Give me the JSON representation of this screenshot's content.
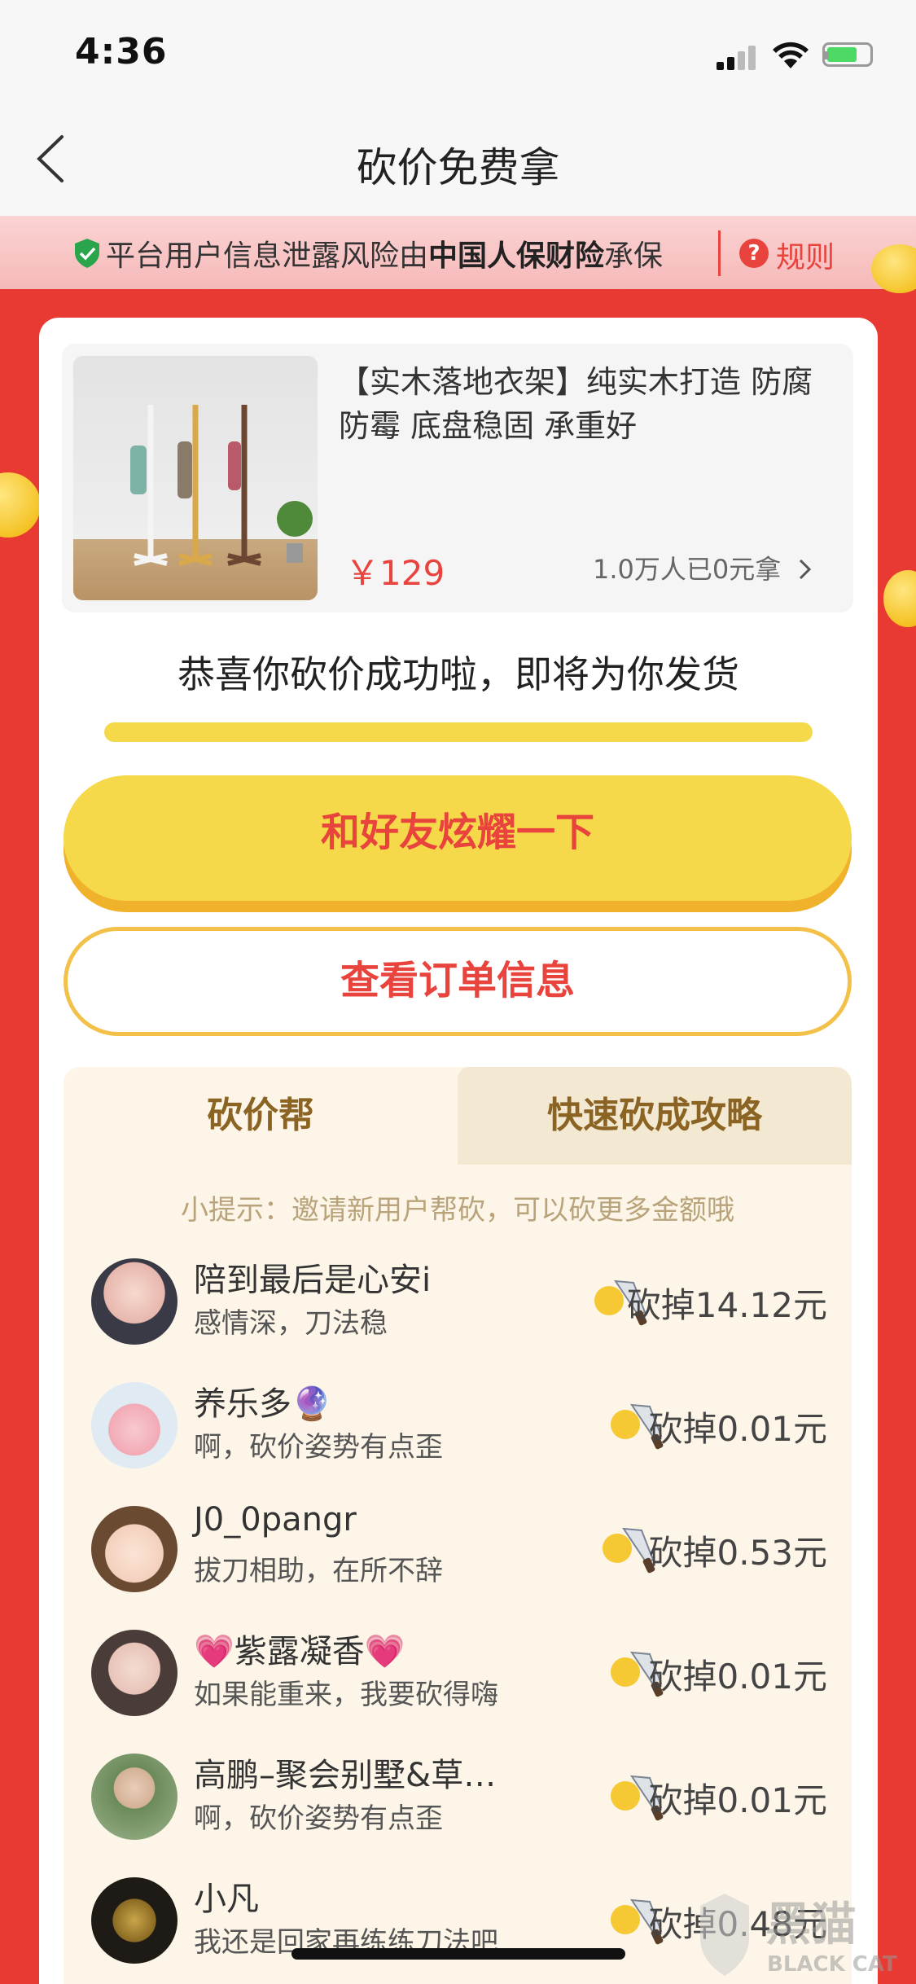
{
  "status_bar": {
    "time": "4:36"
  },
  "nav": {
    "title": "砍价免费拿"
  },
  "insurance": {
    "text_prefix": "平台用户信息泄露风险由",
    "insurer": "中国人保财险",
    "text_suffix": "承保",
    "rule_icon": "?",
    "rule_label": "规则"
  },
  "product": {
    "title": "【实木落地衣架】纯实木打造 防腐防霉 底盘稳固 承重好",
    "price": "￥129",
    "claimed": "1.0万人已0元拿"
  },
  "progress": {
    "message": "恭喜你砍价成功啦，即将为你发货",
    "value_percent": 100
  },
  "buttons": {
    "share": "和好友炫耀一下",
    "order": "查看订单信息"
  },
  "tabs": [
    {
      "label": "砍价帮",
      "active": true
    },
    {
      "label": "快速砍成攻略",
      "active": false
    }
  ],
  "tip": "小提示：邀请新用户帮砍，可以砍更多金额哦",
  "helpers": [
    {
      "name": "陪到最后是心安i",
      "message": "感情深，刀法稳",
      "cut": "砍掉14.12元"
    },
    {
      "name": "养乐多🔮",
      "message": "啊，砍价姿势有点歪",
      "cut": "砍掉0.01元"
    },
    {
      "name": "J0_0pangr",
      "message": "拔刀相助，在所不辞",
      "cut": "砍掉0.53元"
    },
    {
      "name": "💗紫露凝香💗",
      "message": "如果能重来，我要砍得嗨",
      "cut": "砍掉0.01元"
    },
    {
      "name": "高鹏–聚会别墅&草…",
      "message": "啊，砍价姿势有点歪",
      "cut": "砍掉0.01元"
    },
    {
      "name": "小凡",
      "message": "我还是回家再练练刀法吧",
      "cut": "砍掉0.48元"
    }
  ],
  "watermark": {
    "brand": "黑猫",
    "brand_en": "BLACK CAT"
  },
  "colors": {
    "primary_red": "#e8433c",
    "yellow": "#f5d94a",
    "tab_brown": "#8b6322"
  }
}
